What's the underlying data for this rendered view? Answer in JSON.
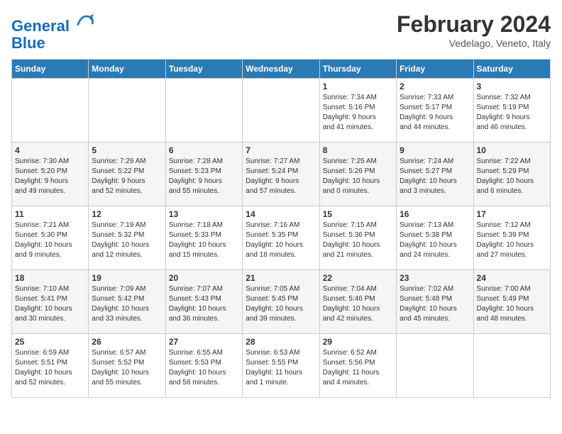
{
  "logo": {
    "line1": "General",
    "line2": "Blue"
  },
  "header": {
    "month": "February 2024",
    "location": "Vedelago, Veneto, Italy"
  },
  "weekdays": [
    "Sunday",
    "Monday",
    "Tuesday",
    "Wednesday",
    "Thursday",
    "Friday",
    "Saturday"
  ],
  "weeks": [
    [
      {
        "day": "",
        "info": ""
      },
      {
        "day": "",
        "info": ""
      },
      {
        "day": "",
        "info": ""
      },
      {
        "day": "",
        "info": ""
      },
      {
        "day": "1",
        "info": "Sunrise: 7:34 AM\nSunset: 5:16 PM\nDaylight: 9 hours\nand 41 minutes."
      },
      {
        "day": "2",
        "info": "Sunrise: 7:33 AM\nSunset: 5:17 PM\nDaylight: 9 hours\nand 44 minutes."
      },
      {
        "day": "3",
        "info": "Sunrise: 7:32 AM\nSunset: 5:19 PM\nDaylight: 9 hours\nand 46 minutes."
      }
    ],
    [
      {
        "day": "4",
        "info": "Sunrise: 7:30 AM\nSunset: 5:20 PM\nDaylight: 9 hours\nand 49 minutes."
      },
      {
        "day": "5",
        "info": "Sunrise: 7:29 AM\nSunset: 5:22 PM\nDaylight: 9 hours\nand 52 minutes."
      },
      {
        "day": "6",
        "info": "Sunrise: 7:28 AM\nSunset: 5:23 PM\nDaylight: 9 hours\nand 55 minutes."
      },
      {
        "day": "7",
        "info": "Sunrise: 7:27 AM\nSunset: 5:24 PM\nDaylight: 9 hours\nand 57 minutes."
      },
      {
        "day": "8",
        "info": "Sunrise: 7:25 AM\nSunset: 5:26 PM\nDaylight: 10 hours\nand 0 minutes."
      },
      {
        "day": "9",
        "info": "Sunrise: 7:24 AM\nSunset: 5:27 PM\nDaylight: 10 hours\nand 3 minutes."
      },
      {
        "day": "10",
        "info": "Sunrise: 7:22 AM\nSunset: 5:29 PM\nDaylight: 10 hours\nand 6 minutes."
      }
    ],
    [
      {
        "day": "11",
        "info": "Sunrise: 7:21 AM\nSunset: 5:30 PM\nDaylight: 10 hours\nand 9 minutes."
      },
      {
        "day": "12",
        "info": "Sunrise: 7:19 AM\nSunset: 5:32 PM\nDaylight: 10 hours\nand 12 minutes."
      },
      {
        "day": "13",
        "info": "Sunrise: 7:18 AM\nSunset: 5:33 PM\nDaylight: 10 hours\nand 15 minutes."
      },
      {
        "day": "14",
        "info": "Sunrise: 7:16 AM\nSunset: 5:35 PM\nDaylight: 10 hours\nand 18 minutes."
      },
      {
        "day": "15",
        "info": "Sunrise: 7:15 AM\nSunset: 5:36 PM\nDaylight: 10 hours\nand 21 minutes."
      },
      {
        "day": "16",
        "info": "Sunrise: 7:13 AM\nSunset: 5:38 PM\nDaylight: 10 hours\nand 24 minutes."
      },
      {
        "day": "17",
        "info": "Sunrise: 7:12 AM\nSunset: 5:39 PM\nDaylight: 10 hours\nand 27 minutes."
      }
    ],
    [
      {
        "day": "18",
        "info": "Sunrise: 7:10 AM\nSunset: 5:41 PM\nDaylight: 10 hours\nand 30 minutes."
      },
      {
        "day": "19",
        "info": "Sunrise: 7:09 AM\nSunset: 5:42 PM\nDaylight: 10 hours\nand 33 minutes."
      },
      {
        "day": "20",
        "info": "Sunrise: 7:07 AM\nSunset: 5:43 PM\nDaylight: 10 hours\nand 36 minutes."
      },
      {
        "day": "21",
        "info": "Sunrise: 7:05 AM\nSunset: 5:45 PM\nDaylight: 10 hours\nand 39 minutes."
      },
      {
        "day": "22",
        "info": "Sunrise: 7:04 AM\nSunset: 5:46 PM\nDaylight: 10 hours\nand 42 minutes."
      },
      {
        "day": "23",
        "info": "Sunrise: 7:02 AM\nSunset: 5:48 PM\nDaylight: 10 hours\nand 45 minutes."
      },
      {
        "day": "24",
        "info": "Sunrise: 7:00 AM\nSunset: 5:49 PM\nDaylight: 10 hours\nand 48 minutes."
      }
    ],
    [
      {
        "day": "25",
        "info": "Sunrise: 6:59 AM\nSunset: 5:51 PM\nDaylight: 10 hours\nand 52 minutes."
      },
      {
        "day": "26",
        "info": "Sunrise: 6:57 AM\nSunset: 5:52 PM\nDaylight: 10 hours\nand 55 minutes."
      },
      {
        "day": "27",
        "info": "Sunrise: 6:55 AM\nSunset: 5:53 PM\nDaylight: 10 hours\nand 58 minutes."
      },
      {
        "day": "28",
        "info": "Sunrise: 6:53 AM\nSunset: 5:55 PM\nDaylight: 11 hours\nand 1 minute."
      },
      {
        "day": "29",
        "info": "Sunrise: 6:52 AM\nSunset: 5:56 PM\nDaylight: 11 hours\nand 4 minutes."
      },
      {
        "day": "",
        "info": ""
      },
      {
        "day": "",
        "info": ""
      }
    ]
  ]
}
